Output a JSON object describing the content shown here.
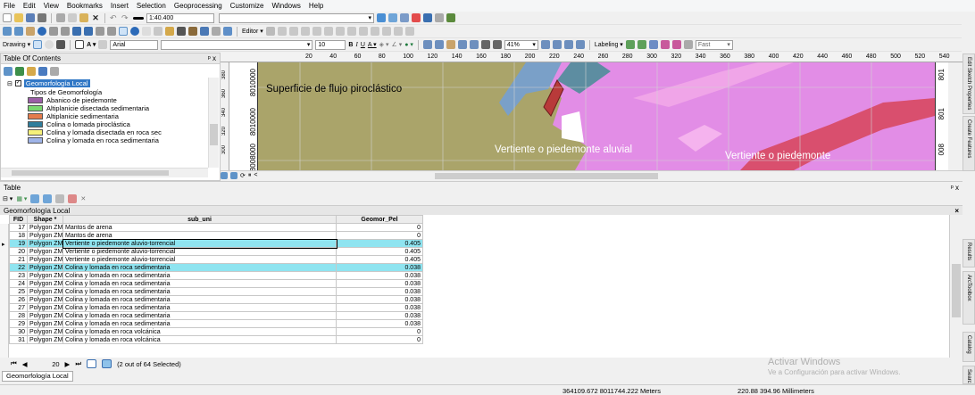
{
  "menu": [
    "File",
    "Edit",
    "View",
    "Bookmarks",
    "Insert",
    "Selection",
    "Geoprocessing",
    "Customize",
    "Windows",
    "Help"
  ],
  "toolbar": {
    "scale": "1:40.400",
    "editor_label": "Editor ▾",
    "drawing_label": "Drawing ▾",
    "font_name": "Arial",
    "font_size": "10",
    "bold": "B",
    "italic": "I",
    "underline": "U",
    "zoom_percent": "41%",
    "labeling_label": "Labeling ▾",
    "fast_label": "Fast"
  },
  "toc": {
    "title": "Table Of Contents",
    "close": "ᵖ x",
    "layer_name": "Geomorfología Local",
    "group_label": "Tipos de Geomorfología",
    "legend": [
      {
        "label": "Abanico de piedemonte",
        "color": "#9b5fa6"
      },
      {
        "label": "Altiplanicie disectada sedimentaria",
        "color": "#7ad86e"
      },
      {
        "label": "Altiplanicie sedimentaria",
        "color": "#e57c4c"
      },
      {
        "label": "Colina o lomada piroclástica",
        "color": "#2e7d9c"
      },
      {
        "label": "Colina y lomada disectada en roca sec",
        "color": "#f5f07a"
      },
      {
        "label": "Colina y lomada en roca sedimentaria",
        "color": "#9fb4e8"
      }
    ]
  },
  "map": {
    "labels": {
      "flujo": "Superficie de flujo piroclástico",
      "vertiente1": "Vertiente o piedemonte aluvial",
      "vertiente2": "Vertiente o piedemonte"
    },
    "x_ruler": [
      "20",
      "40",
      "60",
      "80",
      "100",
      "120",
      "140",
      "160",
      "180",
      "200",
      "220",
      "240",
      "260",
      "280",
      "300",
      "320",
      "340",
      "360",
      "380",
      "400",
      "420",
      "440",
      "460",
      "480",
      "500",
      "520",
      "540",
      "560",
      "580",
      "6"
    ],
    "y_ruler_left": [
      "380",
      "360",
      "340",
      "320",
      "300"
    ],
    "y_coords": [
      "8010000",
      "8010000",
      "8008000"
    ],
    "y_coords_right": [
      "801",
      "801",
      "008"
    ]
  },
  "table_panel": {
    "title": "Table",
    "close": "ᵖ x",
    "tab_title": "Geomorfología Local",
    "columns": [
      "FID",
      "Shape *",
      "sub_uni",
      "Geomor_Pel"
    ],
    "rows": [
      {
        "fid": "17",
        "shape": "Polygon ZM",
        "sub": "Mantos de arena",
        "val": "0"
      },
      {
        "fid": "18",
        "shape": "Polygon ZM",
        "sub": "Mantos de arena",
        "val": "0"
      },
      {
        "fid": "19",
        "shape": "Polygon ZM",
        "sub": "Vertiente o piedemonte aluvio-torrencial",
        "val": "0.405"
      },
      {
        "fid": "20",
        "shape": "Polygon ZM",
        "sub": "Vertiente o piedemonte aluvio-torrencial",
        "val": "0.405"
      },
      {
        "fid": "21",
        "shape": "Polygon ZM",
        "sub": "Vertiente o piedemonte aluvio-torrencial",
        "val": "0.405"
      },
      {
        "fid": "22",
        "shape": "Polygon ZM",
        "sub": "Colina y lomada en roca sedimentaria",
        "val": "0.038"
      },
      {
        "fid": "23",
        "shape": "Polygon ZM",
        "sub": "Colina y lomada en roca sedimentaria",
        "val": "0.038"
      },
      {
        "fid": "24",
        "shape": "Polygon ZM",
        "sub": "Colina y lomada en roca sedimentaria",
        "val": "0.038"
      },
      {
        "fid": "25",
        "shape": "Polygon ZM",
        "sub": "Colina y lomada en roca sedimentaria",
        "val": "0.038"
      },
      {
        "fid": "26",
        "shape": "Polygon ZM",
        "sub": "Colina y lomada en roca sedimentaria",
        "val": "0.038"
      },
      {
        "fid": "27",
        "shape": "Polygon ZM",
        "sub": "Colina y lomada en roca sedimentaria",
        "val": "0.038"
      },
      {
        "fid": "28",
        "shape": "Polygon ZM",
        "sub": "Colina y lomada en roca sedimentaria",
        "val": "0.038"
      },
      {
        "fid": "29",
        "shape": "Polygon ZM",
        "sub": "Colina y lomada en roca sedimentaria",
        "val": "0.038"
      },
      {
        "fid": "30",
        "shape": "Polygon ZM",
        "sub": "Colina y lomada en roca volcánica",
        "val": "0"
      },
      {
        "fid": "31",
        "shape": "Polygon ZM",
        "sub": "Colina y lomada en roca volcánica",
        "val": "0"
      }
    ],
    "selected_fids": [
      "19",
      "22"
    ],
    "current_fid": "19",
    "nav_record": "20",
    "selection_status": "(2 out of 64 Selected)",
    "bottom_tab": "Geomorfología Local"
  },
  "status": {
    "coords": "364109.672  8011744.222 Meters",
    "page_size": "220.88  394.96 Millimeters"
  },
  "watermark": {
    "title": "Activar Windows",
    "subtitle": "Ve a Configuración para activar Windows."
  },
  "side_tabs": [
    "Edit Sketch Properties",
    "Create Features",
    "Results",
    "ArcToolbox",
    "Catalog",
    "Searc"
  ]
}
